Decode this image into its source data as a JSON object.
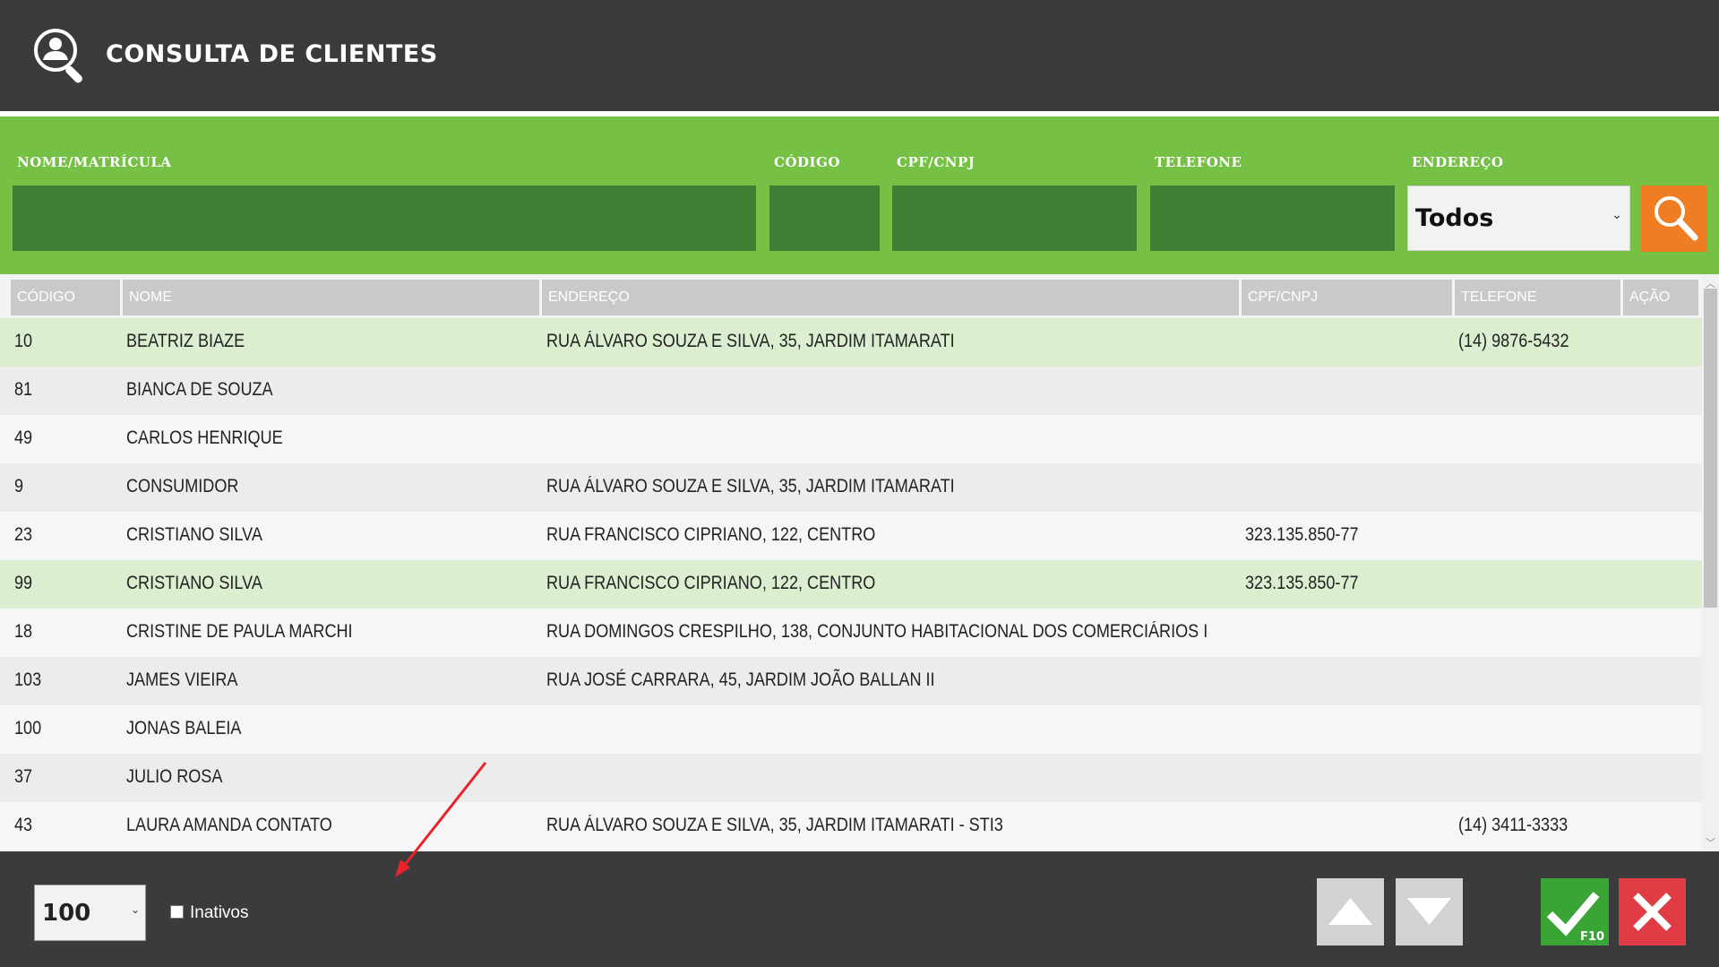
{
  "header": {
    "title": "CONSULTA DE CLIENTES",
    "icon": "user-search-icon"
  },
  "filters": {
    "nome_label": "NOME/MATRÍCULA",
    "codigo_label": "CÓDIGO",
    "cpf_label": "CPF/CNPJ",
    "telefone_label": "TELEFONE",
    "endereco_label": "ENDEREÇO",
    "nome_value": "",
    "codigo_value": "",
    "cpf_value": "",
    "telefone_value": "",
    "endereco_selected": "Todos"
  },
  "table": {
    "columns": [
      "CÓDIGO",
      "NOME",
      "ENDEREÇO",
      "CPF/CNPJ",
      "TELEFONE",
      "AÇÃO"
    ],
    "rows": [
      {
        "codigo": "10",
        "nome": "BEATRIZ BIAZE",
        "endereco": "RUA ÁLVARO SOUZA E SILVA, 35, JARDIM ITAMARATI",
        "cpf": "",
        "telefone": "(14) 9876-5432",
        "selected": true
      },
      {
        "codigo": "81",
        "nome": "BIANCA DE SOUZA",
        "endereco": "",
        "cpf": "",
        "telefone": "",
        "selected": false
      },
      {
        "codigo": "49",
        "nome": "CARLOS HENRIQUE",
        "endereco": "",
        "cpf": "",
        "telefone": "",
        "selected": false
      },
      {
        "codigo": "9",
        "nome": "CONSUMIDOR",
        "endereco": "RUA ÁLVARO SOUZA E SILVA, 35, JARDIM ITAMARATI",
        "cpf": "",
        "telefone": "",
        "selected": false
      },
      {
        "codigo": "23",
        "nome": "CRISTIANO SILVA",
        "endereco": "RUA FRANCISCO CIPRIANO, 122, CENTRO",
        "cpf": "323.135.850-77",
        "telefone": "",
        "selected": false
      },
      {
        "codigo": "99",
        "nome": "CRISTIANO SILVA",
        "endereco": "RUA FRANCISCO CIPRIANO, 122, CENTRO",
        "cpf": "323.135.850-77",
        "telefone": "",
        "selected": true
      },
      {
        "codigo": "18",
        "nome": "CRISTINE DE PAULA MARCHI",
        "endereco": "RUA DOMINGOS CRESPILHO, 138, CONJUNTO HABITACIONAL DOS COMERCIÁRIOS I",
        "cpf": "",
        "telefone": "",
        "selected": false
      },
      {
        "codigo": "103",
        "nome": "JAMES VIEIRA",
        "endereco": "RUA JOSÉ CARRARA, 45, JARDIM JOÃO BALLAN II",
        "cpf": "",
        "telefone": "",
        "selected": false
      },
      {
        "codigo": "100",
        "nome": "JONAS BALEIA",
        "endereco": "",
        "cpf": "",
        "telefone": "",
        "selected": false
      },
      {
        "codigo": "37",
        "nome": "JULIO ROSA",
        "endereco": "",
        "cpf": "",
        "telefone": "",
        "selected": false
      },
      {
        "codigo": "43",
        "nome": "LAURA AMANDA CONTATO",
        "endereco": "RUA ÁLVARO SOUZA E SILVA, 35, JARDIM ITAMARATI - STI3",
        "cpf": "",
        "telefone": "(14) 3411-3333",
        "selected": false
      }
    ]
  },
  "footer": {
    "page_size": "100",
    "inativos_label": "Inativos",
    "inativos_checked": false,
    "confirm_shortcut": "F10"
  },
  "colors": {
    "header_bg": "#3b3b3d",
    "filter_bg": "#75c045",
    "input_bg": "#407f33",
    "search_btn": "#f07d22",
    "confirm_btn": "#3aa536",
    "cancel_btn": "#e03c45",
    "selected_row": "#dbeed0",
    "annotation_arrow": "#e8232a"
  }
}
